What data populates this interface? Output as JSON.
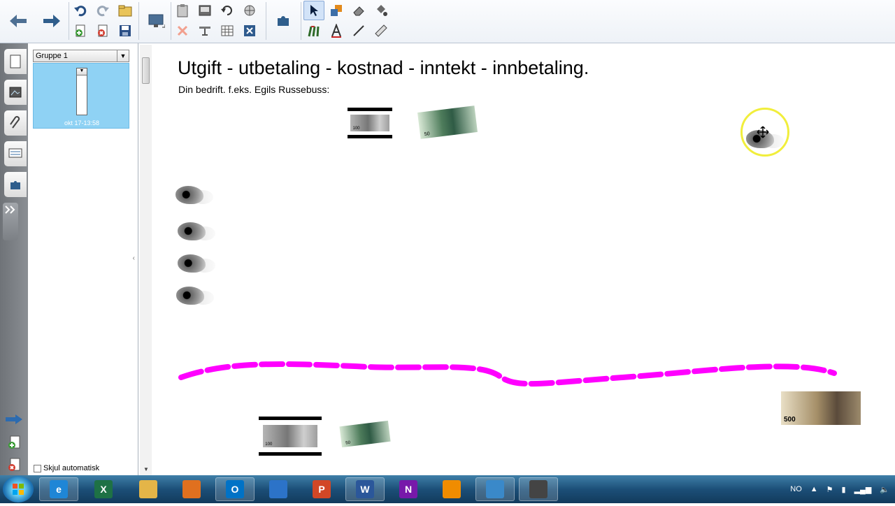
{
  "toolbar": {
    "back_icon": "arrow-left-icon",
    "forward_icon": "arrow-right-icon",
    "tools": [
      "undo",
      "redo",
      "open",
      "new-page",
      "delete-page",
      "save",
      "screen-capture",
      "paste",
      "screen-shade",
      "reset",
      "insert-picture",
      "delete",
      "show-hide",
      "table",
      "close",
      "add-on",
      "select",
      "shapes",
      "eraser",
      "fill",
      "pens",
      "text",
      "line",
      "magic-pen"
    ]
  },
  "sidebar": {
    "tab_icons": [
      "page-sorter-icon",
      "gallery-icon",
      "attachments-icon",
      "properties-icon",
      "add-ons-icon"
    ],
    "group_name": "Gruppe 1",
    "thumbnail_label": "okt 17-13:58",
    "autohide_label": "Skjul automatisk"
  },
  "canvas": {
    "title": "Utgift - utbetaling - kostnad - inntekt - innbetaling.",
    "subtitle": "Din bedrift. f.eks. Egils Russebuss:",
    "note_labels": {
      "n100": "100",
      "n50": "50",
      "n500": "500"
    },
    "ink_color": "#ff00ff"
  },
  "taskbar": {
    "apps": [
      {
        "name": "internet-explorer",
        "label": "e"
      },
      {
        "name": "excel",
        "label": "X"
      },
      {
        "name": "explorer",
        "label": ""
      },
      {
        "name": "media-player",
        "label": ""
      },
      {
        "name": "outlook",
        "label": "O"
      },
      {
        "name": "skydrive",
        "label": ""
      },
      {
        "name": "powerpoint",
        "label": "P"
      },
      {
        "name": "word",
        "label": "W"
      },
      {
        "name": "onenote",
        "label": "N"
      },
      {
        "name": "vlc",
        "label": ""
      },
      {
        "name": "smart-notebook",
        "label": ""
      },
      {
        "name": "screen-recorder",
        "label": ""
      }
    ],
    "language": "NO"
  }
}
